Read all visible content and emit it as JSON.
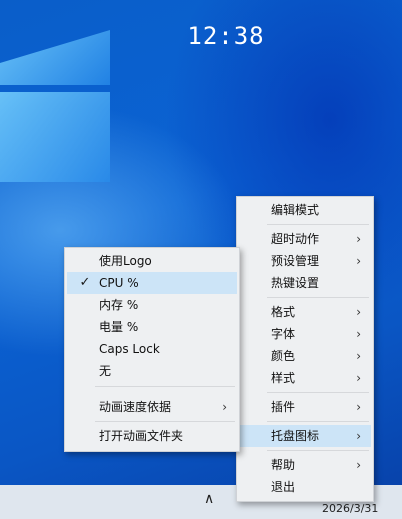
{
  "desktop": {
    "clock": "12:38",
    "accent_color": "#0b63d4"
  },
  "taskbar": {
    "up_icon": "chevron-up-icon",
    "date": "2026/3/31"
  },
  "main_menu": {
    "items": [
      {
        "label": "编辑模式",
        "submenu": false
      },
      {
        "label": "超时动作",
        "submenu": true
      },
      {
        "label": "预设管理",
        "submenu": true
      },
      {
        "label": "热键设置",
        "submenu": false
      },
      {
        "label": "格式",
        "submenu": true
      },
      {
        "label": "字体",
        "submenu": true
      },
      {
        "label": "颜色",
        "submenu": true
      },
      {
        "label": "样式",
        "submenu": true
      },
      {
        "label": "插件",
        "submenu": true
      },
      {
        "label": "托盘图标",
        "submenu": true,
        "highlighted": true
      },
      {
        "label": "帮助",
        "submenu": true
      },
      {
        "label": "退出",
        "submenu": false
      }
    ]
  },
  "sub_menu": {
    "items": [
      {
        "label": "使用Logo",
        "checked": false
      },
      {
        "label": "CPU %",
        "checked": true
      },
      {
        "label": "内存 %",
        "checked": false
      },
      {
        "label": "电量 %",
        "checked": false
      },
      {
        "label": "Caps Lock",
        "checked": false
      },
      {
        "label": "无",
        "checked": false
      },
      {
        "label": "动画速度依据",
        "submenu": true
      },
      {
        "label": "打开动画文件夹",
        "submenu": false
      }
    ]
  },
  "glyphs": {
    "arrow": "›",
    "check": "✓",
    "up": "∧"
  }
}
